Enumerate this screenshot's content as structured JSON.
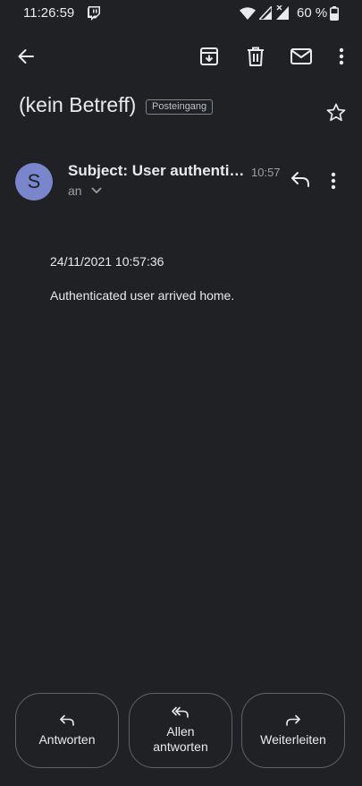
{
  "status_bar": {
    "time": "11:26:59",
    "battery": "60 %"
  },
  "email": {
    "subject": "(kein Betreff)",
    "label": "Posteingang",
    "sender_initial": "S",
    "sender_subject": "Subject: User authentic...",
    "time": "10:57",
    "recipient": "an",
    "body_date": "24/11/2021 10:57:36",
    "body_text": "Authenticated user arrived home."
  },
  "actions": {
    "reply": "Antworten",
    "reply_all_line1": "Allen",
    "reply_all_line2": "antworten",
    "forward": "Weiterleiten"
  },
  "colors": {
    "background": "#202124",
    "avatar": "#7986cb"
  }
}
